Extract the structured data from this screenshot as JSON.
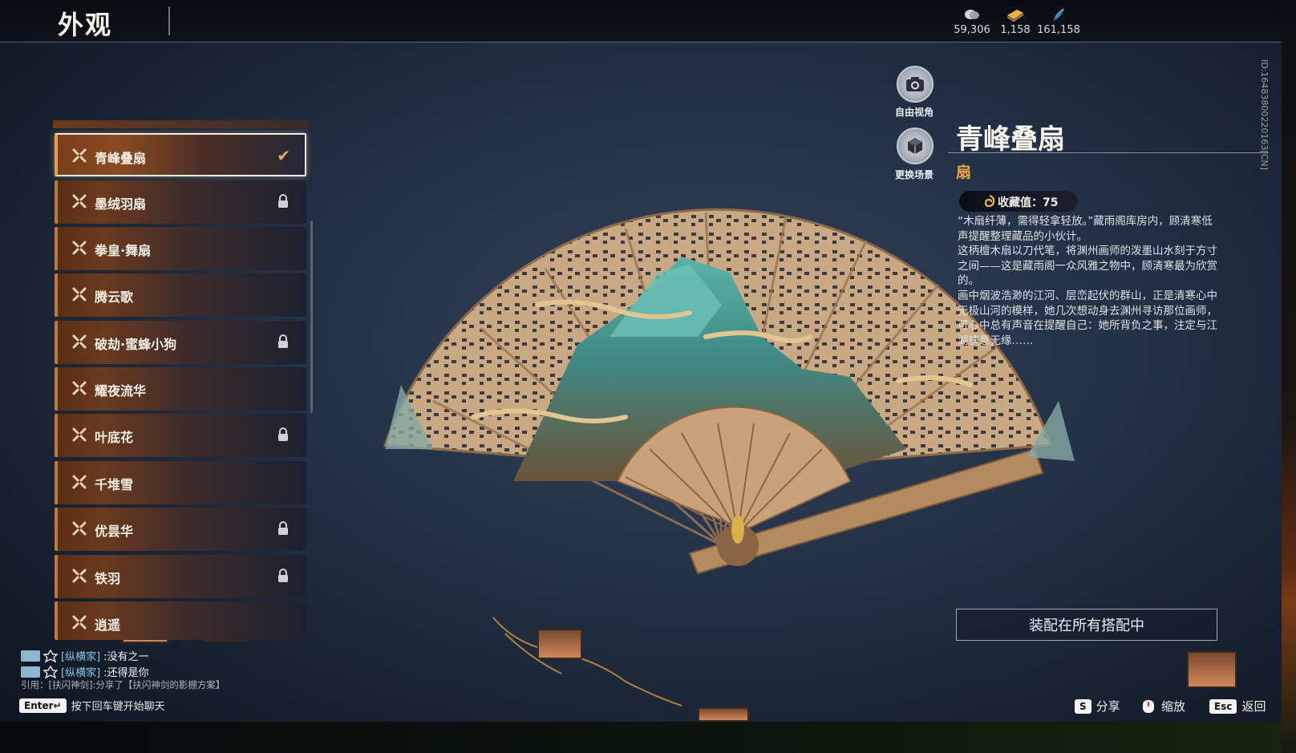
{
  "header": {
    "title": "外观",
    "currencies": [
      {
        "icon": "silver-coin-icon",
        "value": "59,306"
      },
      {
        "icon": "gold-ticket-icon",
        "value": "1,158"
      },
      {
        "icon": "feather-token-icon",
        "value": "161,158"
      }
    ]
  },
  "list": {
    "items": [
      {
        "label": "青峰叠扇",
        "state": "selected"
      },
      {
        "label": "墨绒羽扇",
        "state": "locked"
      },
      {
        "label": "拳皇·舞扇",
        "state": "owned"
      },
      {
        "label": "腾云歌",
        "state": "owned"
      },
      {
        "label": "破劫·蜜蜂小狗",
        "state": "locked"
      },
      {
        "label": "耀夜流华",
        "state": "owned"
      },
      {
        "label": "叶底花",
        "state": "locked"
      },
      {
        "label": "千堆雪",
        "state": "owned"
      },
      {
        "label": "优昙华",
        "state": "locked"
      },
      {
        "label": "铁羽",
        "state": "locked"
      },
      {
        "label": "逍遥",
        "state": "owned"
      }
    ]
  },
  "view_buttons": {
    "free_camera": "自由视角",
    "change_scene": "更换场景"
  },
  "detail": {
    "name": "青峰叠扇",
    "type": "扇",
    "collect_label": "收藏值：75",
    "description": [
      "“木扇纤薄，需得轻拿轻放。”藏雨阁库房内，顾清寒低声提醒整理藏品的小伙计。",
      "这柄檀木扇以刀代笔，将渊州画师的泼墨山水刻于方寸之间——这是藏雨阁一众风雅之物中，顾清寒最为欣赏的。",
      "画中烟波浩渺的江河、层峦起伏的群山，正是清寒心中无极山河的模样，她几次想动身去渊州寻访那位画师，可心中总有声音在提醒自己：她所背负之事，注定与江湖快意无缘……"
    ],
    "id_text": "ID:1648380022016​3[CN]",
    "equip_button": "装配在所有搭配中"
  },
  "footer": {
    "share_key": "S",
    "share_label": "分享",
    "zoom_label": "缩放",
    "back_key": "Esc",
    "back_label": "返回"
  },
  "chat": {
    "lines": [
      {
        "name": "[纵横家]",
        "text": ":没有之一"
      },
      {
        "name": "[纵横家]",
        "text": ":还得是你"
      }
    ],
    "quote": "引用：[扶闪神剑]:分享了【扶闪神剑的影棚方案】",
    "enter_key": "Enter↵",
    "enter_hint": "按下回车键开始聊天"
  },
  "colors": {
    "accent_orange": "#e7a84a",
    "check_orange": "#f0a860",
    "chat_name": "#7fc8e8"
  }
}
